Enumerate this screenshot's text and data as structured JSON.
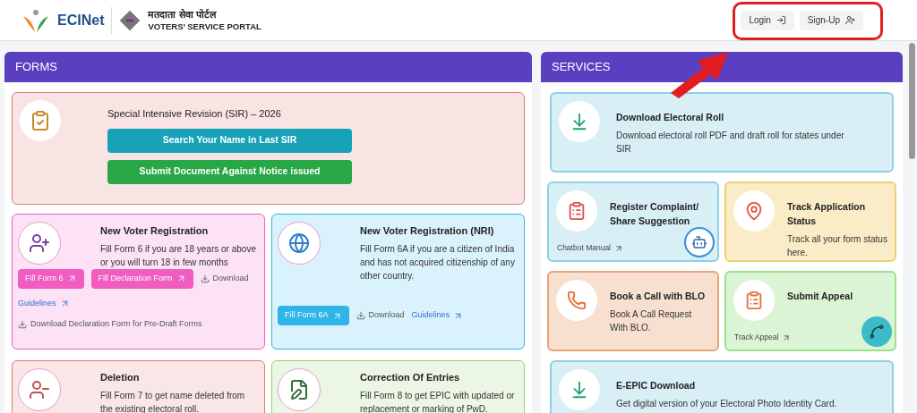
{
  "header": {
    "logo_text": "ECINet",
    "title_hindi": "मतदाता सेवा पोर्टल",
    "title_english": "VOTERS’ SERVICE PORTAL",
    "buttons": [
      {
        "label": "Login",
        "kind": "login"
      },
      {
        "label": "Sign-Up",
        "kind": "signup"
      }
    ]
  },
  "forms": {
    "title": "FORMS",
    "sir": {
      "title": "Special Intensive Revision (SIR) – 2026",
      "color": "#e07a7a",
      "buttons": [
        {
          "label": "Search Your Name in Last SIR",
          "color": "#17a2b8"
        },
        {
          "label": "Submit Document Against Notice issued",
          "color": "#28a745"
        }
      ]
    },
    "cards": [
      {
        "kind": "add",
        "title": "New Voter Registration",
        "text": "Fill Form 6 if you are 18 years or above or you will turn 18 in few months",
        "color": "#f05cc0",
        "actions": [
          {
            "kind": "button",
            "label": "Fill Form 6"
          },
          {
            "kind": "button",
            "label": "Fill Declaration Form"
          },
          {
            "kind": "download",
            "label": "Download"
          },
          {
            "kind": "link",
            "label": "Guidelines"
          },
          {
            "kind": "download",
            "label": "Download Declaration Form for Pre-Draft Forms"
          }
        ]
      },
      {
        "kind": "nri",
        "title": "New Voter Registration (NRI)",
        "text": "Fill Form 6A if you are a citizen of India and has not acquired citizenship of any other country.",
        "color": "#2fb5e8",
        "actions": [
          {
            "kind": "button",
            "label": "Fill Form 6A"
          },
          {
            "kind": "download",
            "label": "Download"
          },
          {
            "kind": "link",
            "label": "Guidelines"
          }
        ]
      },
      {
        "kind": "delete",
        "title": "Deletion",
        "text": "Fill Form 7 to get name deleted from the existing electoral roll.",
        "color": "#e07a7a"
      },
      {
        "kind": "correct",
        "title": "Correction Of Entries",
        "text": "Fill Form 8 to get EPIC with updated or replacement or marking of PwD.",
        "color": "#8fd46a"
      }
    ]
  },
  "services": {
    "title": "SERVICES",
    "cards": [
      {
        "kind": "download",
        "title": "Download Electoral Roll",
        "text": "Download electoral roll PDF and draft roll for states under SIR",
        "color": "#8fd0e6"
      },
      {
        "kind": "complaint",
        "title": "Register Complaint/ Share Suggestion",
        "color": "#8fd0e6",
        "link": "Chatbot Manual"
      },
      {
        "kind": "track",
        "title": "Track Application Status",
        "text": "Track all your form status here.",
        "color": "#f0cf72"
      },
      {
        "kind": "call",
        "title": "Book a Call with BLO",
        "text": "Book A Call Request With BLO.",
        "color": "#e8a57a"
      },
      {
        "kind": "appeal",
        "title": "Submit Appeal",
        "color": "#9be08a",
        "link": "Track Appeal"
      },
      {
        "kind": "download",
        "title": "E-EPIC Download",
        "text": "Get digital version of your Electoral Photo Identity Card.",
        "color": "#8fd0e6"
      }
    ]
  }
}
